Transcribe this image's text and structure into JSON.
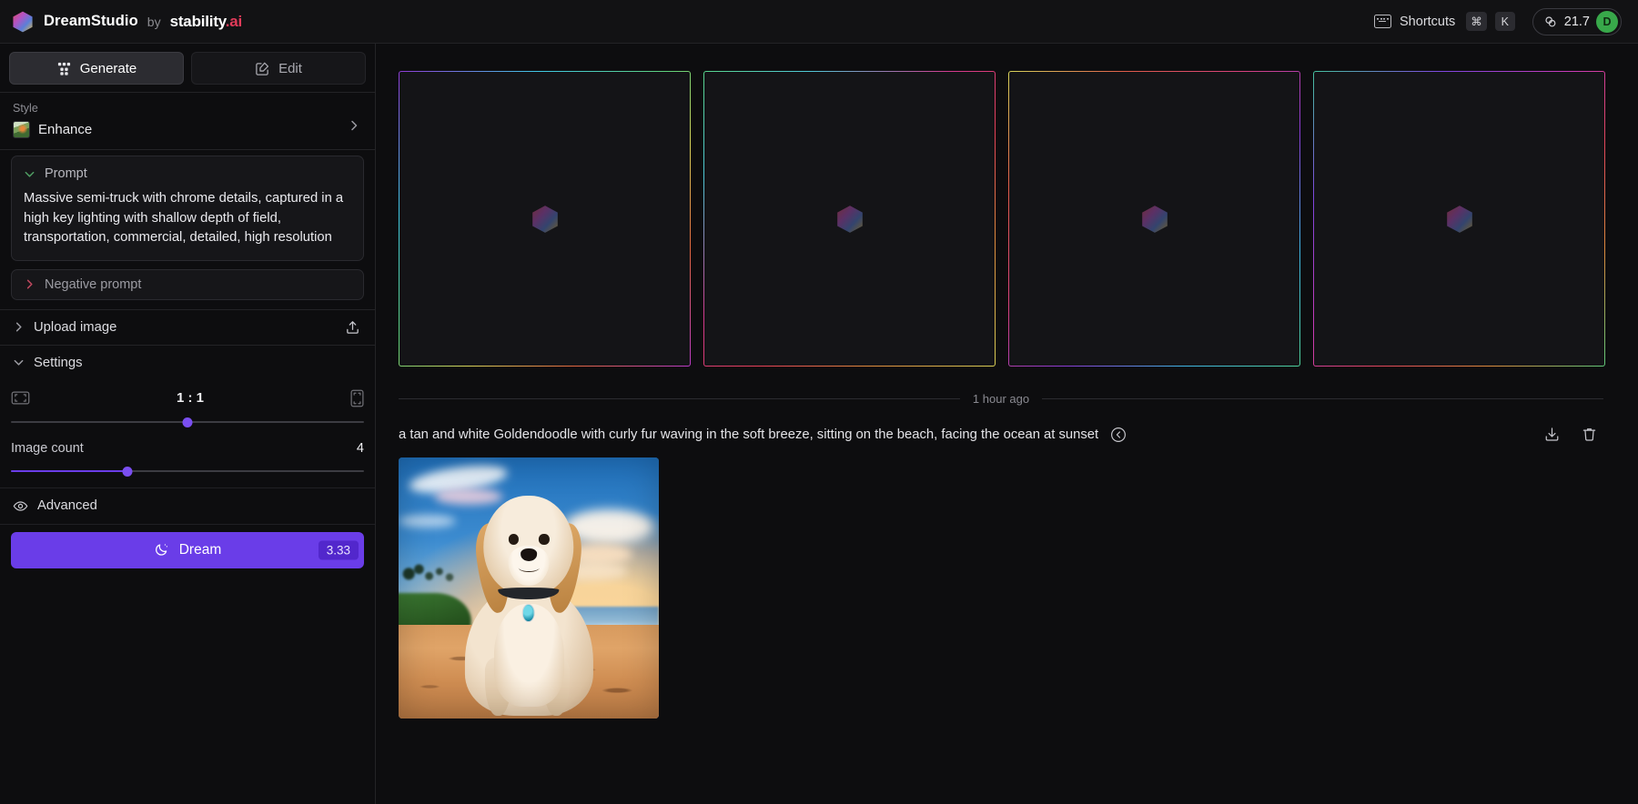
{
  "topbar": {
    "brand_name": "DreamStudio",
    "brand_by": "by",
    "brand_stability": "stability",
    "brand_stability_suffix": ".ai",
    "keyboard_icon": "keyboard-icon",
    "shortcuts_label": "Shortcuts",
    "key_cmd": "⌘",
    "key_k": "K",
    "credits_icon": "credits-coin-icon",
    "credits_value": "21.7",
    "avatar_initial": "D",
    "avatar_color": "#38a84a"
  },
  "sidebar": {
    "tabs": [
      {
        "label": "Generate",
        "icon": "grid-generate-icon",
        "active": true
      },
      {
        "label": "Edit",
        "icon": "pencil-square-icon",
        "active": false
      }
    ],
    "style": {
      "label": "Style",
      "value": "Enhance",
      "thumb_icon": "style-thumbnail",
      "chevron_icon": "chevron-right-icon"
    },
    "prompt": {
      "label": "Prompt",
      "chevron_icon": "chevron-down-icon",
      "chevron_color": "#4f9d62",
      "value": "Massive semi-truck with chrome details, captured in a high key lighting with shallow depth of field, transportation, commercial, detailed, high resolution"
    },
    "negative_prompt": {
      "label": "Negative prompt",
      "chevron_icon": "chevron-right-icon",
      "chevron_color": "#c0485f",
      "value": ""
    },
    "upload_image": {
      "label": "Upload image",
      "chevron_icon": "chevron-right-icon",
      "upload_icon": "upload-icon"
    },
    "settings": {
      "label": "Settings",
      "chevron_icon": "chevron-down-icon",
      "aspect_ratio": {
        "value": "1 : 1",
        "left_icon": "landscape-ratio-icon",
        "right_icon": "portrait-ratio-icon",
        "slider_percent": 50
      },
      "image_count": {
        "label": "Image count",
        "value": "4",
        "slider_percent": 33
      }
    },
    "advanced": {
      "label": "Advanced",
      "icon": "eye-icon"
    },
    "dream_button": {
      "label": "Dream",
      "icon": "moon-icon",
      "cost": "3.33",
      "color": "#6a3de8"
    }
  },
  "main": {
    "generating_tiles": [
      {
        "name": "generating-tile-1",
        "logo_icon": "hexagon-logo-icon"
      },
      {
        "name": "generating-tile-2",
        "logo_icon": "hexagon-logo-icon"
      },
      {
        "name": "generating-tile-3",
        "logo_icon": "hexagon-logo-icon"
      },
      {
        "name": "generating-tile-4",
        "logo_icon": "hexagon-logo-icon"
      }
    ],
    "time_divider_label": "1 hour ago",
    "history": {
      "prompt": "a tan and white Goldendoodle with curly fur waving in the soft breeze, sitting on the beach, facing the ocean at sunset",
      "reuse_icon": "arrow-left-circle-icon",
      "download_icon": "download-icon",
      "delete_icon": "trash-icon",
      "image_alt": "goldendoodle-on-beach-at-sunset"
    }
  }
}
